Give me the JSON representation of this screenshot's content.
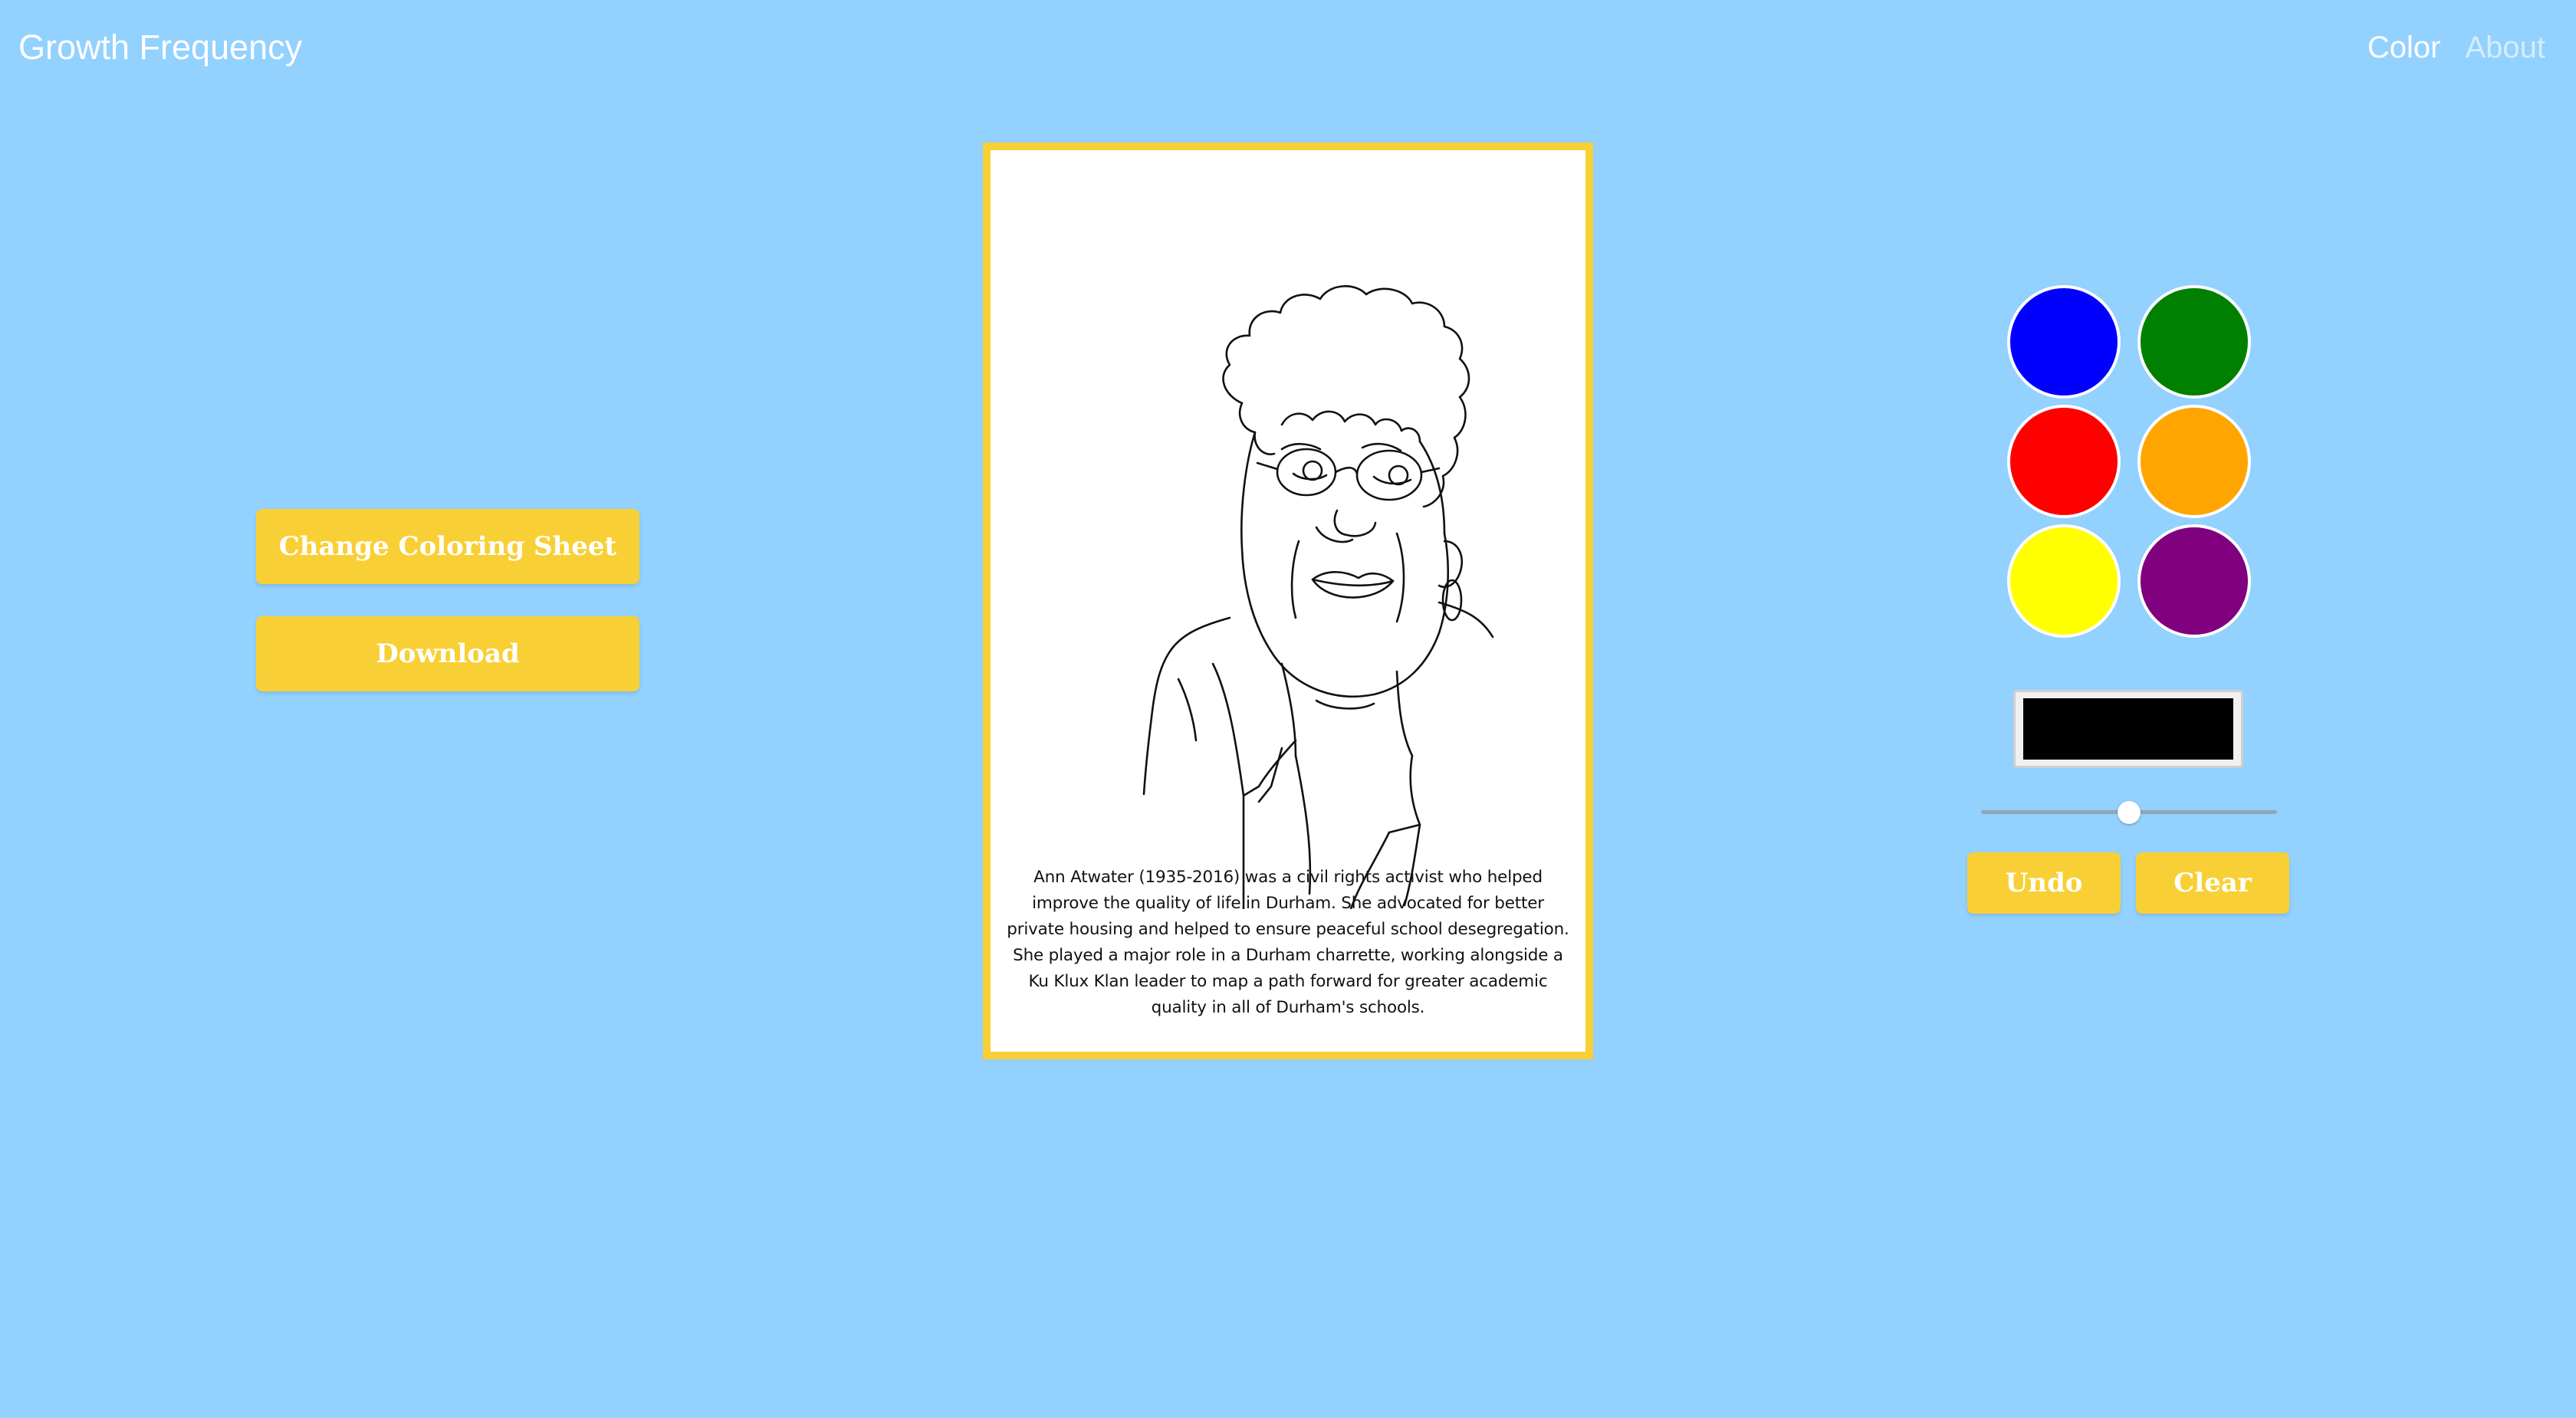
{
  "header": {
    "brand": "Growth Frequency",
    "nav": [
      {
        "label": "Color",
        "active": true
      },
      {
        "label": "About",
        "active": false
      }
    ]
  },
  "actions": {
    "change_sheet_label": "Change Coloring Sheet",
    "download_label": "Download"
  },
  "sheet": {
    "caption": "Ann Atwater (1935-2016) was a civil rights activist who helped improve the quality of life in Durham. She advocated for better private housing and helped to ensure peaceful school desegregation. She played a major role in a Durham charrette, working alongside a Ku Klux Klan leader to map a path forward for greater academic quality in all of Durham's schools."
  },
  "palette": {
    "colors": [
      {
        "name": "blue",
        "hex": "#0000ff"
      },
      {
        "name": "green",
        "hex": "#008000"
      },
      {
        "name": "red",
        "hex": "#ff0000"
      },
      {
        "name": "orange",
        "hex": "#ffa500"
      },
      {
        "name": "yellow",
        "hex": "#ffff00"
      },
      {
        "name": "purple",
        "hex": "#800080"
      }
    ],
    "current_color": "#000000",
    "brush_size_fraction": 0.5
  },
  "controls": {
    "undo_label": "Undo",
    "clear_label": "Clear"
  },
  "theme": {
    "background": "#93d1fe",
    "accent": "#f8d035"
  }
}
